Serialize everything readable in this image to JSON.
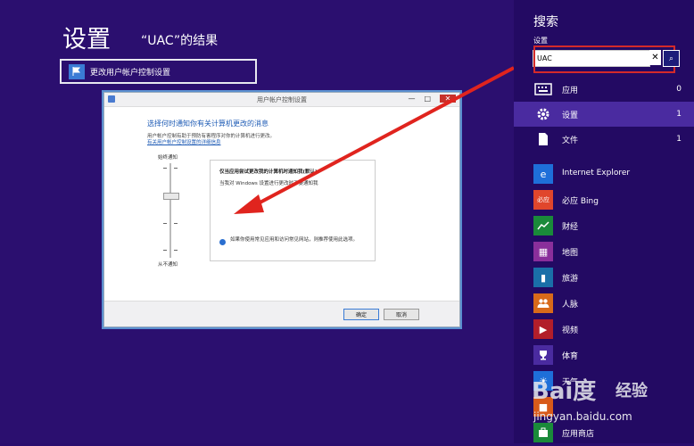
{
  "results": {
    "title": "设置",
    "subtitle": "“UAC”的结果",
    "items": [
      {
        "label": "更改用户帐户控制设置"
      }
    ]
  },
  "dialog": {
    "title": "用户帐户控制设置",
    "heading": "选择何时通知你有关计算机更改的消息",
    "description": "用户帐户控制有助于预防有害程序对你的计算机进行更改。",
    "link": "有关用户帐户控制设置的详细信息",
    "slider_top_label": "始终通知",
    "slider_bottom_label": "从不通知",
    "info_heading": "仅当应用尝试更改我的计算机时通知我(默认)",
    "info_bullet": "当我对 Windows 设置进行更改时不要通知我",
    "info_note": "如果你使用常见应用和访问常见网站，则推荐使用此选项。",
    "ok_label": "确定",
    "cancel_label": "取消",
    "minimize": "—",
    "maximize": "□",
    "close": "✕"
  },
  "charm": {
    "title": "搜索",
    "scope_label": "设置",
    "search_value": "UAC",
    "clear_glyph": "✕",
    "go_glyph": "⌕",
    "categories": [
      {
        "label": "应用",
        "count": "0",
        "icon": "keyboard-icon",
        "selected": false
      },
      {
        "label": "设置",
        "count": "1",
        "icon": "gear-icon",
        "selected": true
      },
      {
        "label": "文件",
        "count": "1",
        "icon": "document-icon",
        "selected": false
      }
    ],
    "apps": [
      {
        "label": "Internet Explorer",
        "icon": "ie-icon",
        "color": "#1e6fd9"
      },
      {
        "label": "必应 Bing",
        "icon": "bing-icon",
        "color": "#e0462c"
      },
      {
        "label": "财经",
        "icon": "finance-icon",
        "color": "#1a8a3a"
      },
      {
        "label": "地图",
        "icon": "maps-icon",
        "color": "#8a2f9b"
      },
      {
        "label": "旅游",
        "icon": "travel-icon",
        "color": "#1a6fa8"
      },
      {
        "label": "人脉",
        "icon": "people-icon",
        "color": "#d86a1a"
      },
      {
        "label": "视频",
        "icon": "video-icon",
        "color": "#b21e2a"
      },
      {
        "label": "体育",
        "icon": "sports-icon",
        "color": "#4a2ba0"
      },
      {
        "label": "天气",
        "icon": "weather-icon",
        "color": "#1e6fd9"
      },
      {
        "label": "",
        "icon": "app-icon",
        "color": "#d85a1a"
      },
      {
        "label": "应用商店",
        "icon": "store-icon",
        "color": "#1a8a3a"
      }
    ]
  },
  "watermark": {
    "logo": "Bai度",
    "brand": "经验",
    "url": "jingyan.baidu.com"
  },
  "colors": {
    "background": "#2b0f6f",
    "charm_background": "#230a63",
    "selected": "#4a2ba0",
    "highlight": "#d42a2a",
    "arrow": "#e0241e"
  }
}
